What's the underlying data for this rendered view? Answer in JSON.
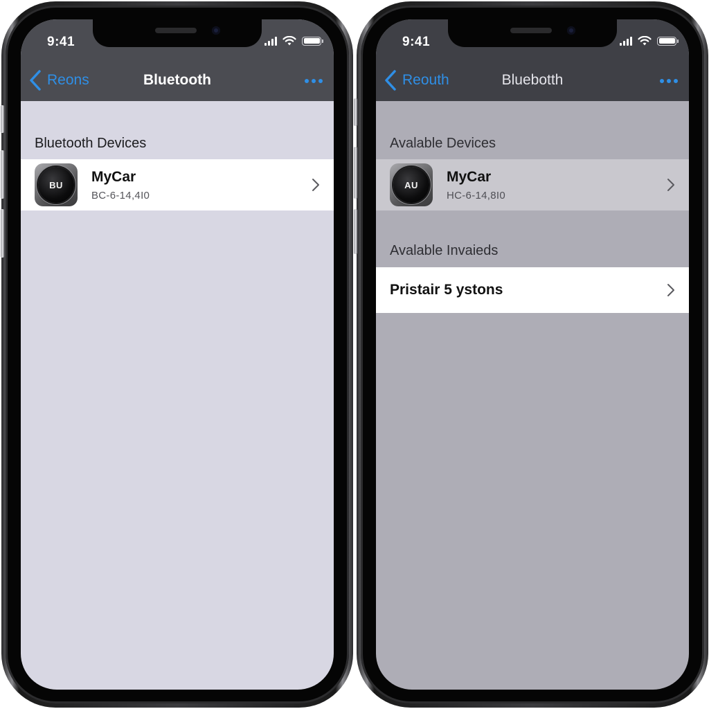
{
  "phones": [
    {
      "status_bar": {
        "time": "9:41"
      },
      "nav": {
        "back_label": "Reons",
        "title": "Bluetooth",
        "more_icon": "ellipsis-icon"
      },
      "sections": [
        {
          "header": "Bluetooth Devices",
          "rows": [
            {
              "icon_label": "BU",
              "name": "MyCar",
              "address": "BC-6-14,4I0"
            }
          ]
        }
      ]
    },
    {
      "status_bar": {
        "time": "9:41"
      },
      "nav": {
        "back_label": "Reouth",
        "title": "Bluebotth",
        "more_icon": "ellipsis-icon"
      },
      "sections": [
        {
          "header": "Avalable Devices",
          "rows": [
            {
              "icon_label": "AU",
              "name": "MyCar",
              "address": "HC-6-14,8I0"
            }
          ]
        },
        {
          "header": "Avalable Invaieds",
          "rows": [
            {
              "label": "Pristair 5 ystons"
            }
          ]
        }
      ]
    }
  ],
  "colors": {
    "accent": "#2f8fe6",
    "nav_bg_left": "#4b4c52",
    "nav_bg_right": "#3f4046",
    "screen_bg_left": "#d8d7e3",
    "screen_bg_right": "#aeadb6"
  }
}
